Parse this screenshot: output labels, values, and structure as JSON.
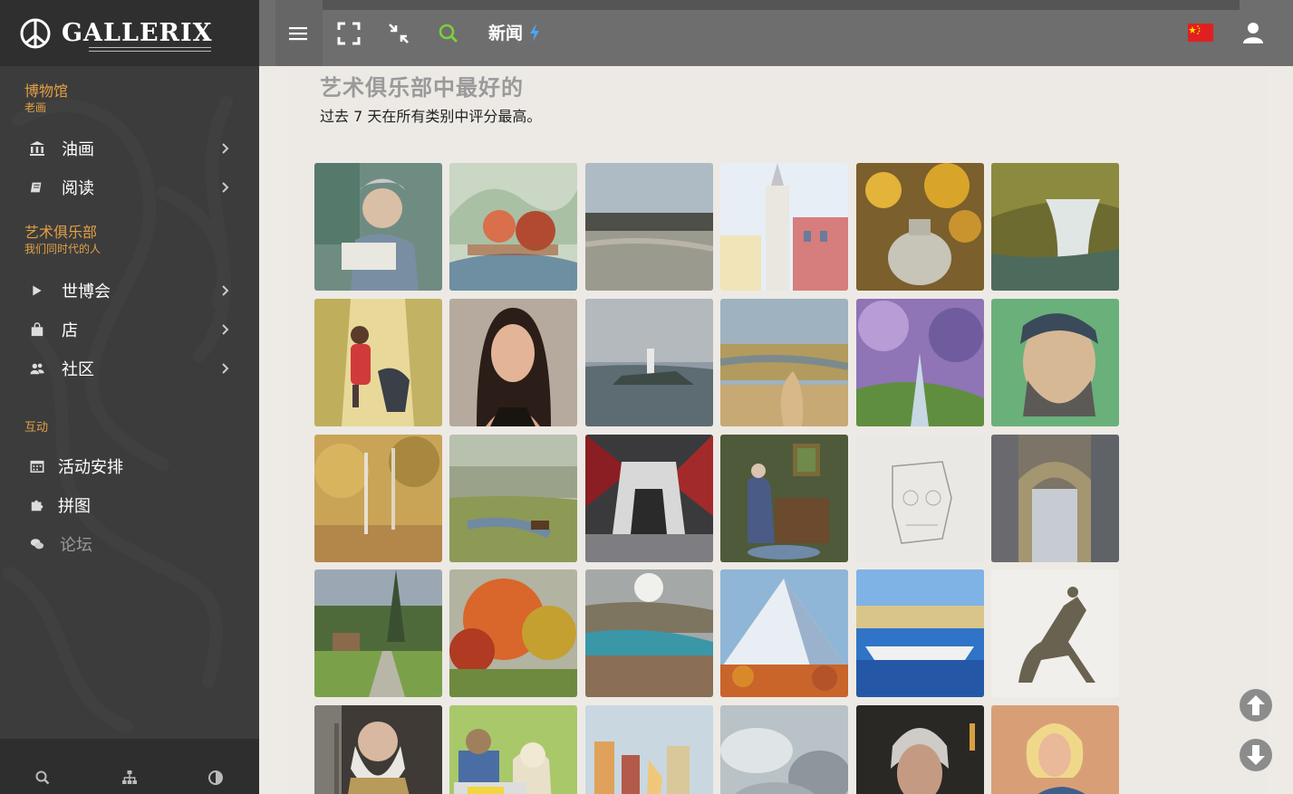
{
  "logo": {
    "text": "GALLERIX"
  },
  "sidebar": {
    "museum": {
      "title": "博物馆",
      "subtitle": "老画"
    },
    "museum_items": [
      {
        "label": "油画",
        "icon": "museum-icon"
      },
      {
        "label": "阅读",
        "icon": "book-icon"
      }
    ],
    "club": {
      "title": "艺术俱乐部",
      "subtitle": "我们同时代的人"
    },
    "club_items": [
      {
        "label": "世博会",
        "icon": "play-icon"
      },
      {
        "label": "店",
        "icon": "shopping-bag-icon"
      },
      {
        "label": "社区",
        "icon": "users-icon"
      }
    ],
    "interactive": {
      "title": "互动"
    },
    "interactive_items": [
      {
        "label": "活动安排",
        "icon": "calendar-icon"
      },
      {
        "label": "拼图",
        "icon": "puzzle-icon"
      },
      {
        "label": "论坛",
        "icon": "comments-icon"
      }
    ],
    "footer_icons": [
      "search-icon",
      "sitemap-icon",
      "contrast-icon"
    ]
  },
  "topbar": {
    "news_label": "新闻",
    "icons": [
      "menu-icon",
      "fullscreen-icon",
      "compress-icon",
      "search-icon",
      "lightning-icon",
      "china-flag-icon",
      "user-icon"
    ],
    "accent_color": "#7ccf3c"
  },
  "main": {
    "title": "艺术俱乐部中最好的",
    "subtitle": "过去 7 天在所有类别中评分最高。",
    "gallery_rows": 5,
    "gallery_cols": 6
  },
  "scroll": {
    "icons": [
      "arrow-up-circle-icon",
      "arrow-down-circle-icon"
    ]
  }
}
